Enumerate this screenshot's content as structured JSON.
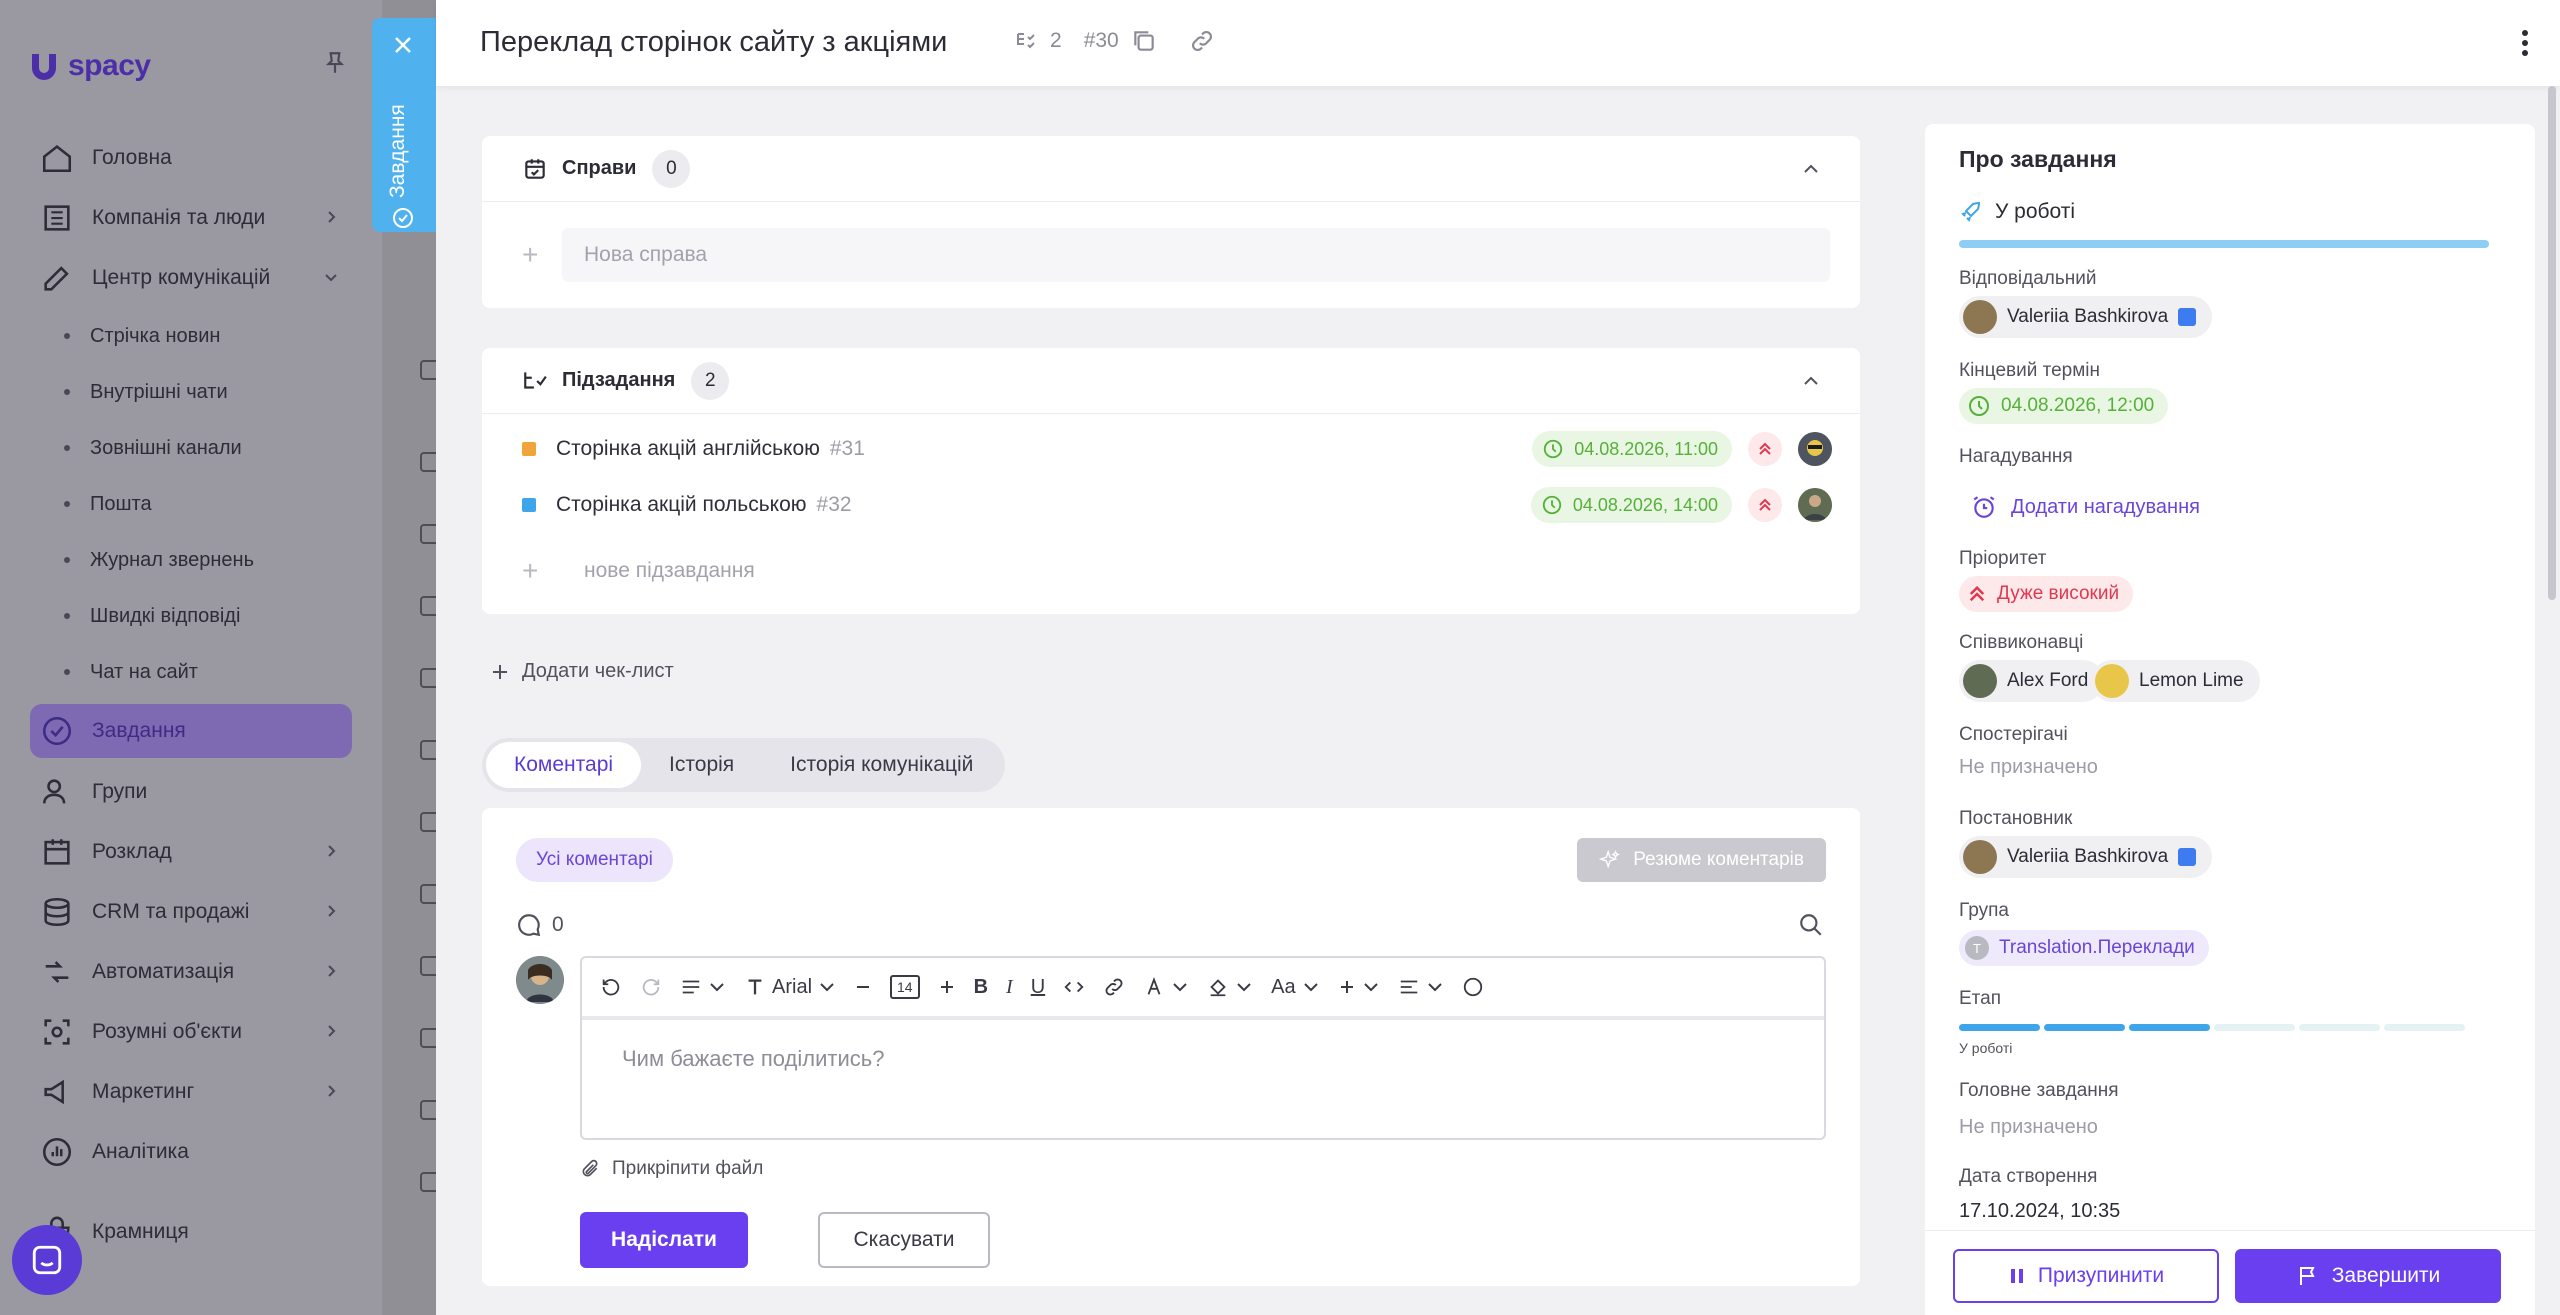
{
  "sidebar": {
    "logo": "spacy",
    "items": [
      {
        "label": "Головна"
      },
      {
        "label": "Компанія та люди"
      },
      {
        "label": "Центр комунікацій"
      },
      {
        "label": "Завдання"
      },
      {
        "label": "Групи"
      },
      {
        "label": "Розклад"
      },
      {
        "label": "CRM та продажі"
      },
      {
        "label": "Автоматизація"
      },
      {
        "label": "Розумні об'єкти"
      },
      {
        "label": "Маркетинг"
      },
      {
        "label": "Аналітика"
      },
      {
        "label": "Крамниця"
      }
    ],
    "sub_items": [
      {
        "label": "Стрічка новин"
      },
      {
        "label": "Внутрішні чати"
      },
      {
        "label": "Зовнішні канали"
      },
      {
        "label": "Пошта"
      },
      {
        "label": "Журнал звернень"
      },
      {
        "label": "Швидкі відповіді"
      },
      {
        "label": "Чат на сайт"
      }
    ]
  },
  "side_tab": {
    "label": "Завдання"
  },
  "header": {
    "title": "Переклад сторінок сайту з акціями",
    "subtask_count": "2",
    "task_number": "#30"
  },
  "cases": {
    "title": "Справи",
    "count": "0",
    "new_placeholder": "Нова справа"
  },
  "subtasks": {
    "title": "Підзадання",
    "count": "2",
    "items": [
      {
        "name": "Сторінка акцій англійською",
        "number": "#31",
        "deadline": "04.08.2026, 11:00",
        "color": "#f0a53a"
      },
      {
        "name": "Сторінка акцій польською",
        "number": "#32",
        "deadline": "04.08.2026, 14:00",
        "color": "#3ea5ea"
      }
    ],
    "new_placeholder": "нове підзавдання"
  },
  "add_checklist": "Додати чек-лист",
  "tabs": [
    {
      "label": "Коментарі"
    },
    {
      "label": "Історія"
    },
    {
      "label": "Історія комунікацій"
    }
  ],
  "comments": {
    "filter_all": "Усі коментарі",
    "summary_button": "Резюме коментарів",
    "count": "0",
    "toolbar": {
      "font": "Arial",
      "size": "14",
      "case": "Aa"
    },
    "placeholder": "Чим бажаєте поділитись?",
    "attach": "Прикріпити файл",
    "send": "Надіслати",
    "cancel": "Скасувати"
  },
  "info": {
    "title": "Про завдання",
    "status": "У роботі",
    "responsible_label": "Відповідальний",
    "responsible": "Valeriia Bashkirova",
    "deadline_label": "Кінцевий термін",
    "deadline": "04.08.2026, 12:00",
    "reminder_label": "Нагадування",
    "reminder_add": "Додати нагадування",
    "priority_label": "Пріоритет",
    "priority": "Дуже високий",
    "coexecutors_label": "Співвиконавці",
    "coexecutors": [
      "Alex Ford",
      "Lemon Lime"
    ],
    "observers_label": "Спостерігачі",
    "observers": "Не призначено",
    "creator_label": "Постановник",
    "creator": "Valeriia Bashkirova",
    "group_label": "Група",
    "group": "Translation.Переклади",
    "group_initial": "T",
    "stage_label": "Етап",
    "stage_name": "У роботі",
    "stage_steps_done": 3,
    "stage_steps_total": 6,
    "parent_label": "Головне завдання",
    "parent": "Не призначено",
    "created_label": "Дата створення",
    "created": "17.10.2024, 10:35"
  },
  "footer": {
    "pause": "Призупинити",
    "finish": "Завершити"
  },
  "colors": {
    "accent": "#6a3ff0",
    "tab_blue": "#4fb2ee",
    "deadline_green": "#56b13a",
    "priority_red": "#e0384e"
  }
}
